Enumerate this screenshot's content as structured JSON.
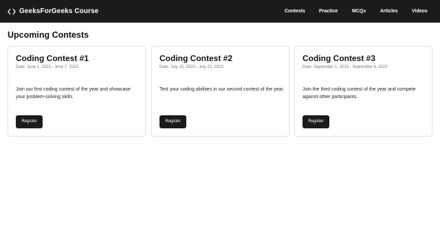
{
  "navbar": {
    "brand_icon": "code-brackets-icon",
    "brand_title": "GeeksForGeeks Course",
    "links": [
      "Contests",
      "Practice",
      "MCQs",
      "Articles",
      "Videos"
    ],
    "background": "#1b1b1b"
  },
  "main": {
    "section_title": "Upcoming Contests",
    "contests": [
      {
        "title": "Coding Contest #1",
        "date": "Date: June 1, 2023 - June 7, 2023",
        "description": "Join our first coding contest of the year and showcase your problem-solving skills.",
        "button_label": "Register"
      },
      {
        "title": "Coding Contest #2",
        "date": "Date: July 15, 2023 - July 22, 2023",
        "description": "Test your coding abilities in our second contest of the year.",
        "button_label": "Register"
      },
      {
        "title": "Coding Contest #3",
        "date": "Date: September 1, 2023 - September 8, 2023",
        "description": "Join the third coding contest of the year and compete against other participants.",
        "button_label": "Register"
      }
    ]
  }
}
